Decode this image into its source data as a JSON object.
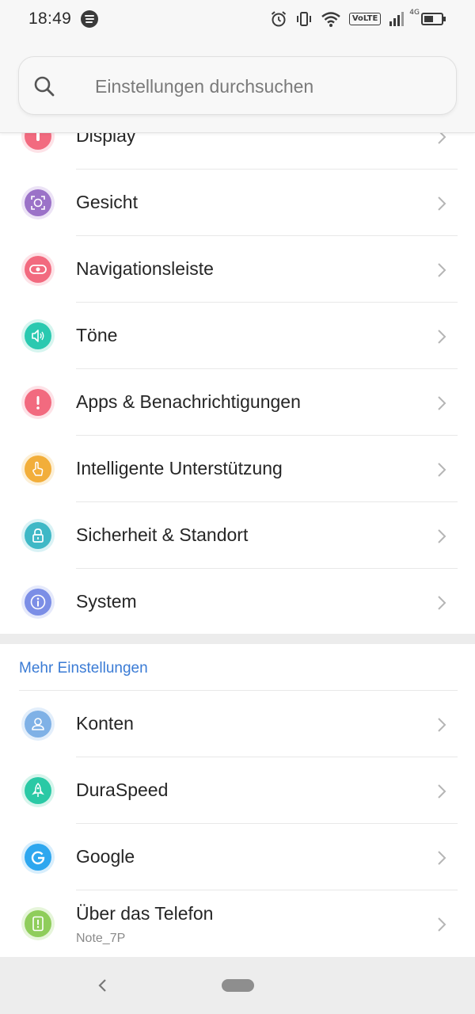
{
  "status": {
    "time": "18:49",
    "volte": "VoLTE",
    "network": "4G"
  },
  "search": {
    "placeholder": "Einstellungen durchsuchen"
  },
  "items": [
    {
      "label": "Display",
      "icon": "display-icon",
      "color": "#f26a7f"
    },
    {
      "label": "Gesicht",
      "icon": "face-icon",
      "color": "#9b72c8"
    },
    {
      "label": "Navigationsleiste",
      "icon": "navigation-bar-icon",
      "color": "#f26a7f"
    },
    {
      "label": "Töne",
      "icon": "sound-icon",
      "color": "#2ac9b0"
    },
    {
      "label": "Apps & Benachrichtigungen",
      "icon": "alert-icon",
      "color": "#f26a7f"
    },
    {
      "label": "Intelligente Unterstützung",
      "icon": "hand-pointer-icon",
      "color": "#f2ae3a"
    },
    {
      "label": "Sicherheit & Standort",
      "icon": "lock-icon",
      "color": "#3fb8c6"
    },
    {
      "label": "System",
      "icon": "info-icon",
      "color": "#7b8ee6"
    }
  ],
  "more": {
    "title": "Mehr Einstellungen",
    "items": [
      {
        "label": "Konten",
        "icon": "account-icon",
        "color": "#7fb1e6"
      },
      {
        "label": "DuraSpeed",
        "icon": "rocket-icon",
        "color": "#2ac9a5"
      },
      {
        "label": "Google",
        "icon": "google-icon",
        "color": "#2ea7ef"
      },
      {
        "label": "Über das Telefon",
        "sublabel": "Note_7P",
        "icon": "phone-info-icon",
        "color": "#8fcd5b"
      }
    ]
  }
}
